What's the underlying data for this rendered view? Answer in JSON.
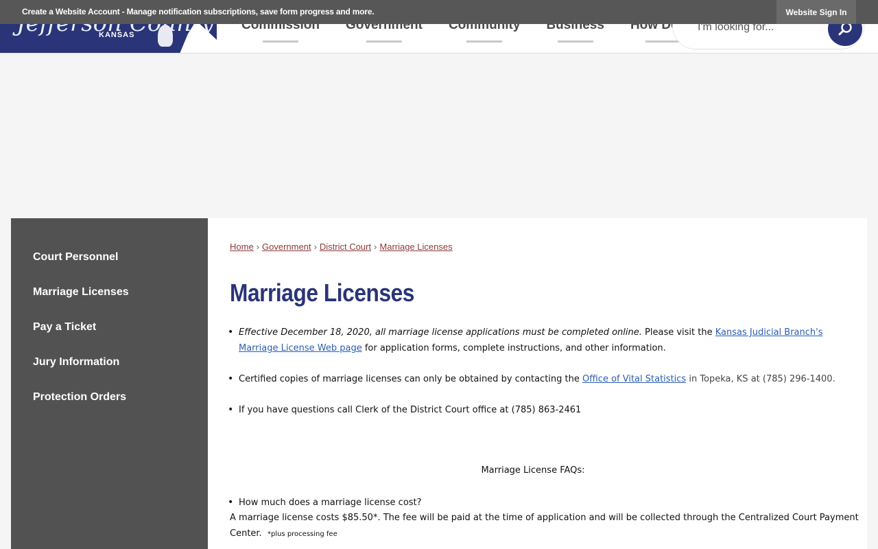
{
  "header": {
    "logo": {
      "county": "Jefferson County",
      "state": "KANSAS"
    },
    "nav": [
      "Commission",
      "Government",
      "Community",
      "Business",
      "How Do I..."
    ],
    "search": {
      "placeholder": "I'm looking for..."
    }
  },
  "notice": {
    "text": "Create a Website Account - Manage notification subscriptions, save form progress and more.",
    "signin": "Website Sign In"
  },
  "sidebar": {
    "items": [
      "Court Personnel",
      "Marriage Licenses",
      "Pay a Ticket",
      "Jury Information",
      "Protection Orders"
    ]
  },
  "breadcrumb": [
    "Home",
    "Government",
    "District Court",
    "Marriage Licenses"
  ],
  "page_title": "Marriage Licenses",
  "bullets": {
    "b1_italic": "Effective December 18, 2020, all marriage license applications must be completed online.",
    "b1_text": "  Please visit the ",
    "b1_link": "Kansas Judicial Branch's Marriage License Web page",
    "b1_tail": " for application forms, complete instructions, and other information.",
    "b2_text": "Certified copies of marriage licenses can only be obtained by contacting the ",
    "b2_link": "Office of Vital Statistics",
    "b2_tail": " in Topeka, KS at (785) 296-1400.",
    "b3_text": "If you have questions call Clerk of the District Court office at (785) 863-2461"
  },
  "faq": {
    "title": "Marriage License FAQs:",
    "q1": "How much does a marriage license cost?",
    "a1": "A marriage license costs $85.50*. The fee will be paid at the time of application and will be collected through the Centralized Court Payment Center.",
    "a1_note": "*plus processing fee"
  }
}
